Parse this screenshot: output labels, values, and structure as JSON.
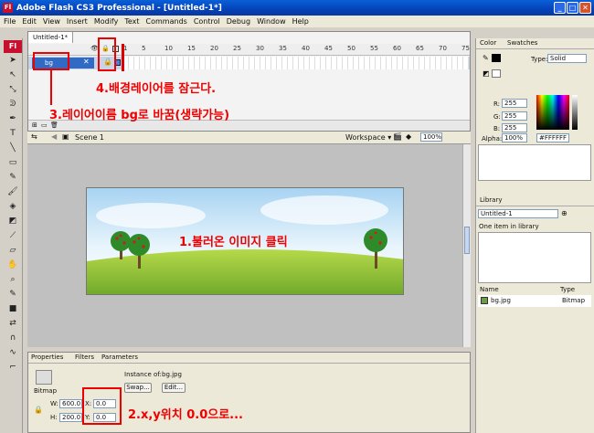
{
  "window": {
    "title": "Adobe Flash CS3 Professional - [Untitled-1*]",
    "app_icon_label": "Fl"
  },
  "menu": [
    "File",
    "Edit",
    "View",
    "Insert",
    "Modify",
    "Text",
    "Commands",
    "Control",
    "Debug",
    "Window",
    "Help"
  ],
  "timeline": {
    "doc_tab": "Untitled-1*",
    "frame_numbers": [
      "1",
      "5",
      "10",
      "15",
      "20",
      "25",
      "30",
      "35",
      "40",
      "45",
      "50",
      "55",
      "60",
      "65",
      "70",
      "75"
    ],
    "layer_name": "bg"
  },
  "scene": {
    "name": "Scene 1",
    "workspace": "Workspace",
    "zoom": "100%"
  },
  "properties": {
    "tabs": [
      "Properties",
      "Filters",
      "Parameters"
    ],
    "type": "Bitmap",
    "instance_of_label": "Instance of:",
    "instance_of": "bg.jpg",
    "swap_label": "Swap...",
    "edit_label": "Edit...",
    "w_label": "W:",
    "w_value": "600.0",
    "h_label": "H:",
    "h_value": "200.0",
    "x_label": "X:",
    "x_value": "0.0",
    "y_label": "Y:",
    "y_value": "0.0"
  },
  "color_panel": {
    "tabs": [
      "Color",
      "Swatches"
    ],
    "type_label": "Type:",
    "type_value": "Solid",
    "r_label": "R:",
    "r": "255",
    "g_label": "G:",
    "g": "255",
    "b_label": "B:",
    "b": "255",
    "alpha_label": "Alpha:",
    "alpha": "100%",
    "hex": "#FFFFFF"
  },
  "library": {
    "tab": "Library",
    "doc": "Untitled-1",
    "count": "One item in library",
    "col_name": "Name",
    "col_type": "Type",
    "item_name": "bg.jpg",
    "item_type": "Bitmap"
  },
  "annotations": {
    "step1": "1.불러온 이미지 클릭",
    "step2": "2.x,y위치 0.0으로...",
    "step3": "3.레이어이름 bg로 바꿈(생략가능)",
    "step4": "4.배경레이어를 잠근다."
  },
  "colors": {
    "annotation": "#ee0000",
    "title_bar": "#0542b8",
    "flash_red": "#c8102e",
    "selection": "#316ac5"
  }
}
